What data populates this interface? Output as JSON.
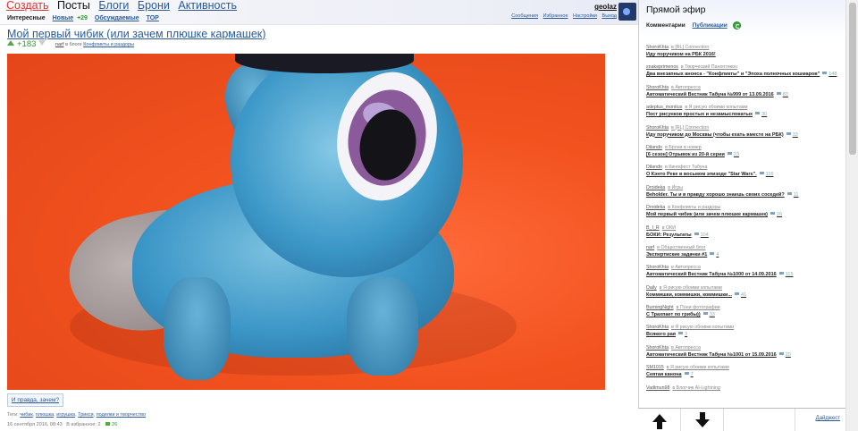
{
  "header": {
    "nav": [
      {
        "label": "Создать",
        "style": "red"
      },
      {
        "label": "Посты",
        "style": "current"
      },
      {
        "label": "Блоги",
        "style": "link"
      },
      {
        "label": "Брони",
        "style": "link"
      },
      {
        "label": "Активность",
        "style": "link"
      }
    ],
    "subnav": {
      "interesting": "Интересные",
      "new": "Новые",
      "new_count": "+29",
      "discussed": "Обсуждаемые",
      "top": "TOP"
    },
    "user": {
      "name": "geolaz",
      "links": [
        "Сообщения",
        "Избранное",
        "Настройки",
        "Выход"
      ]
    }
  },
  "post": {
    "title": "Мой первый чибик (или зачем плюшке кармашек)",
    "rating": "+183",
    "author": "narf",
    "in_blog": "в блоге",
    "blog": "Конфликты и раздоры",
    "more_button": "И правда, зачем?",
    "tags_label": "Теги:",
    "tags": [
      "чибик",
      "плюшка",
      "игрушка",
      "Трикси",
      "поделки и творчество"
    ],
    "date": "16 сентября 2016, 08:43",
    "favorites_label": "В избранное:",
    "favorites": "2",
    "comments": "26"
  },
  "sidebar": {
    "title": "Прямой эфир",
    "tabs": {
      "comments": "Комментарии",
      "publications": "Публикации"
    },
    "feed": [
      {
        "author": "ShoroKhta",
        "blog": "[RL] Connection",
        "post": "Иду поручиком на РБК 2016!",
        "count": ""
      },
      {
        "author": "snakeprimenos",
        "blog": "Творческий Паноптикон",
        "post": "Два внезапных анонса - \"Конфликты\" и \"Эпоха полночных кошмаров\"",
        "count": "148"
      },
      {
        "author": "ShoroKhta",
        "blog": "Автопресса",
        "post": "Автоматический Вестник Табуна №999 от 13.09.2016",
        "count": "83"
      },
      {
        "author": "adeptus_monitus",
        "blog": "Я рисую обоими копытами",
        "post": "Пост рисунков простых и незамысловатых",
        "count": "30"
      },
      {
        "author": "ShoroKhta",
        "blog": "[RL] Connection",
        "post": "Иду поручиком до Москвы (чтобы ехать вместе на РБК)",
        "count": "33"
      },
      {
        "author": "Dilando",
        "blog": "Брони в номер",
        "post": "[6 сезон] Отрывок из 20-й серии",
        "count": "23"
      },
      {
        "author": "Dilando",
        "blog": "Кинофест Табуна",
        "post": "О Кэнто Реке в восьмом эпизоде \"Star Wars\".",
        "count": "116"
      },
      {
        "author": "Droideka",
        "blog": "Игры",
        "post": "Beholder. Ты и в правду хорошо знаешь своих соседей?",
        "count": "11"
      },
      {
        "author": "Droideka",
        "blog": "Конфликты и раздоры",
        "post": "Мой первый чибик (или зачем плюшке кармашек)",
        "count": "26"
      },
      {
        "author": "B_I_R",
        "blog": "ОКИ",
        "post": "БОКИ: Результаты",
        "count": "104"
      },
      {
        "author": "narf",
        "blog": "Общественный блог",
        "post": "Экспертиские задачки #1",
        "count": "4"
      },
      {
        "author": "ShoroKhta",
        "blog": "Автопресса",
        "post": "Автоматический Вестник Табуна №1000 от 14.09.2016",
        "count": "115"
      },
      {
        "author": "Daily",
        "blog": "Я рисую обоими копытами",
        "post": "Коммишки, коммишки, коммишки...",
        "count": "41"
      },
      {
        "author": "BurningNight",
        "blog": "Пони фотографии",
        "post": "С Трахпает по грибы))",
        "count": "33"
      },
      {
        "author": "ShoroKhta",
        "blog": "Я рисую обоими копытами",
        "post": "Всякого рая",
        "count": "3"
      },
      {
        "author": "ShoroKhta",
        "blog": "Автопресса",
        "post": "Автоматический Вестник Табуна №1001 от 15.09.2016",
        "count": "20"
      },
      {
        "author": "SM1015",
        "blog": "Я рисую обоими копытами",
        "post": "Сеятая канона",
        "count": "7"
      },
      {
        "author": "Vadimun98",
        "blog": "Блогчик AI-Lightning",
        "post": "",
        "count": ""
      }
    ],
    "bottom_link": "Дайджест"
  }
}
